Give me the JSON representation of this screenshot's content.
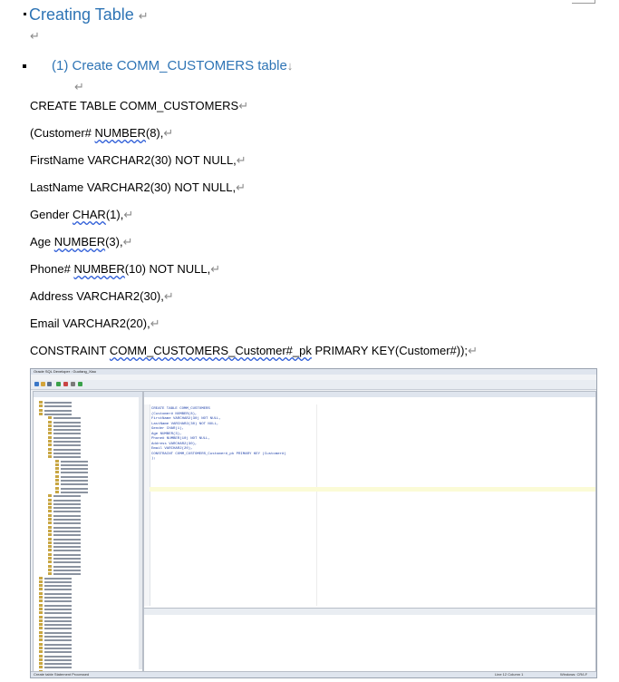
{
  "document": {
    "heading1": "Creating Table",
    "heading2": "(1) Create COMM_CUSTOMERS table",
    "lines": [
      {
        "text": "CREATE TABLE COMM_CUSTOMERS"
      },
      {
        "pre": "(Customer# ",
        "sq": "NUMBER",
        "post": "(8),"
      },
      {
        "text": "FirstName VARCHAR2(30) NOT NULL,"
      },
      {
        "text": "LastName VARCHAR2(30) NOT NULL,"
      },
      {
        "pre": "Gender ",
        "sq": "CHAR",
        "post": "(1),"
      },
      {
        "pre": "Age ",
        "sq": "NUMBER",
        "post": "(3),"
      },
      {
        "pre": "Phone# ",
        "sq": "NUMBER",
        "post": "(10) NOT NULL,"
      },
      {
        "text": "Address VARCHAR2(30),"
      },
      {
        "text": "Email VARCHAR2(20),"
      },
      {
        "pre": "CONSTRAINT ",
        "sq": "COMM_CUSTOMERS_Customer#_pk",
        "post": " PRIMARY KEY(Customer#));"
      }
    ]
  },
  "screenshot": {
    "window_title": "Oracle SQL Developer : Guofang_Xiao",
    "status_left": "Create table Statement Processed",
    "status_mid": "Line 12 Column 1",
    "status_right": "Windows: CR/LF",
    "code": "CREATE TABLE COMM_CUSTOMERS\n(Customer# NUMBER(8),\nFirstName VARCHAR2(30) NOT NULL,\nLastName VARCHAR2(30) NOT NULL,\nGender CHAR(1),\nAge NUMBER(3),\nPhone# NUMBER(10) NOT NULL,\nAddress VARCHAR2(30),\nEmail VARCHAR2(20),\nCONSTRAINT COMM_CUSTOMERS_Customer#_pk PRIMARY KEY (Customer#)\n);"
  }
}
